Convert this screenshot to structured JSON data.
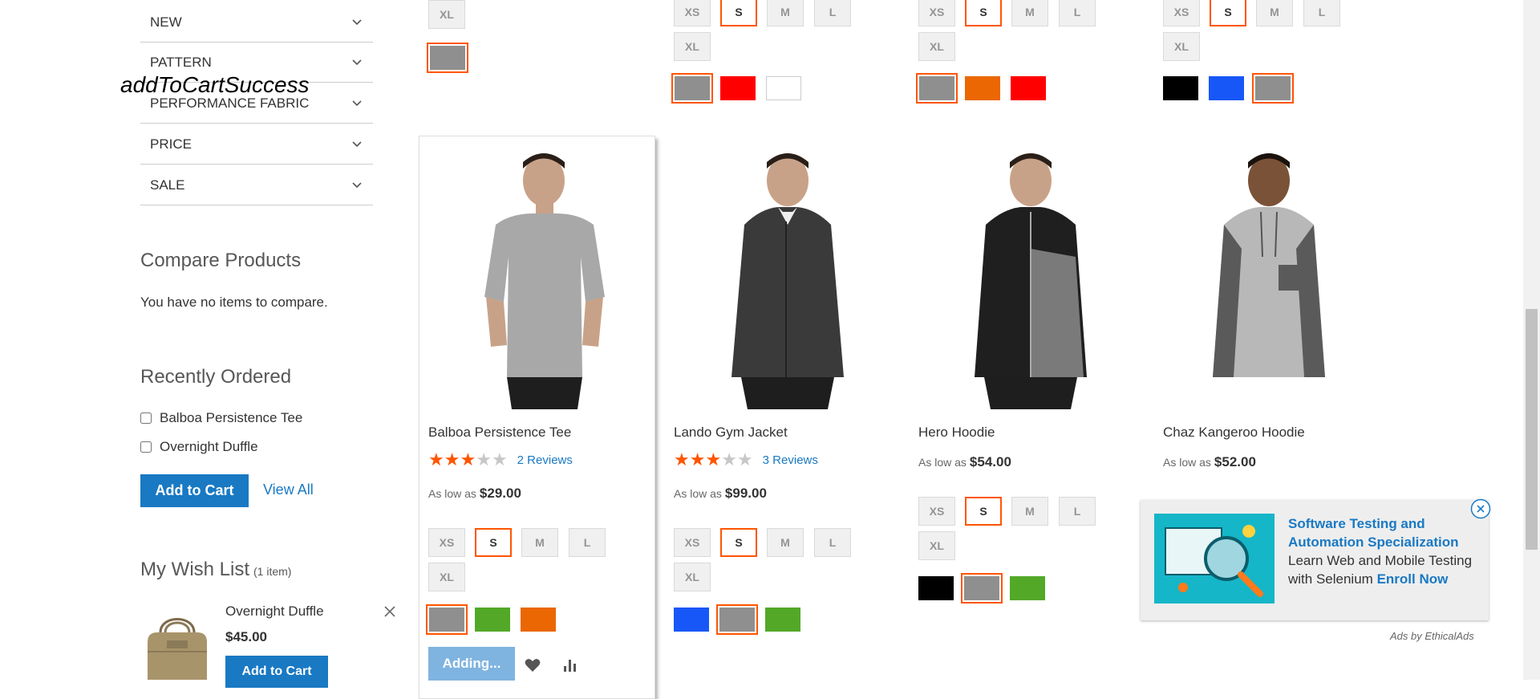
{
  "overlay_text": "addToCartSuccess",
  "filters": [
    {
      "label": "NEW"
    },
    {
      "label": "PATTERN"
    },
    {
      "label": "PERFORMANCE FABRIC"
    },
    {
      "label": "PRICE"
    },
    {
      "label": "SALE"
    }
  ],
  "compare": {
    "title": "Compare Products",
    "empty_text": "You have no items to compare."
  },
  "recently_ordered": {
    "title": "Recently Ordered",
    "items": [
      {
        "label": "Balboa Persistence Tee",
        "checked": false
      },
      {
        "label": "Overnight Duffle",
        "checked": false
      }
    ],
    "add_to_cart_label": "Add to Cart",
    "view_all_label": "View All"
  },
  "wishlist": {
    "title": "My Wish List",
    "count_text": "(1 item)",
    "item_name": "Overnight Duffle",
    "item_price": "$45.00",
    "add_to_cart_label": "Add to Cart"
  },
  "top_row": {
    "col1": {
      "sizes": [
        "XL"
      ],
      "swatches": [
        "#8f8f8f"
      ]
    },
    "col2": {
      "sizes": [
        "XS",
        "S",
        "M",
        "L",
        "XL"
      ],
      "swatches": [
        "#8f8f8f",
        "#ff0000",
        "#ffffff"
      ]
    },
    "col3": {
      "sizes": [
        "XS",
        "S",
        "M",
        "L",
        "XL"
      ],
      "swatches": [
        "#8f8f8f",
        "#eb6703",
        "#ff0000"
      ]
    },
    "col4": {
      "sizes": [
        "XS",
        "S",
        "M",
        "L",
        "XL"
      ],
      "swatches": [
        "#000000",
        "#1857f7",
        "#8f8f8f"
      ]
    }
  },
  "products": [
    {
      "name": "Balboa Persistence Tee",
      "rating": 3,
      "reviews": "2 Reviews",
      "price_prefix": "As low as",
      "price": "$29.00",
      "sizes": [
        "XS",
        "S",
        "M",
        "L",
        "XL"
      ],
      "selected_size": "S",
      "swatches": [
        "#8f8f8f",
        "#53a828",
        "#eb6703"
      ],
      "selected_swatch": 0
    },
    {
      "name": "Lando Gym Jacket",
      "rating": 3,
      "reviews": "3 Reviews",
      "price_prefix": "As low as",
      "price": "$99.00",
      "sizes": [
        "XS",
        "S",
        "M",
        "L",
        "XL"
      ],
      "selected_size": "S",
      "swatches": [
        "#1857f7",
        "#8f8f8f",
        "#53a828"
      ],
      "selected_swatch": 1
    },
    {
      "name": "Hero Hoodie",
      "price_prefix": "As low as",
      "price": "$54.00",
      "sizes": [
        "XS",
        "S",
        "M",
        "L",
        "XL"
      ],
      "selected_size": "S",
      "swatches": [
        "#000000",
        "#8f8f8f",
        "#53a828"
      ],
      "selected_swatch": 1
    },
    {
      "name": "Chaz Kangeroo Hoodie",
      "price_prefix": "As low as",
      "price": "$52.00"
    }
  ],
  "adding_label": "Adding...",
  "ad": {
    "title": "Software Testing and Automation Specialization",
    "body": "Learn Web and Mobile Testing with Selenium",
    "cta": "Enroll Now",
    "footer": "Ads by EthicalAds"
  },
  "colors": {
    "accent": "#1979c3",
    "selected_border": "#ff5501",
    "star_on": "#ff5501"
  }
}
